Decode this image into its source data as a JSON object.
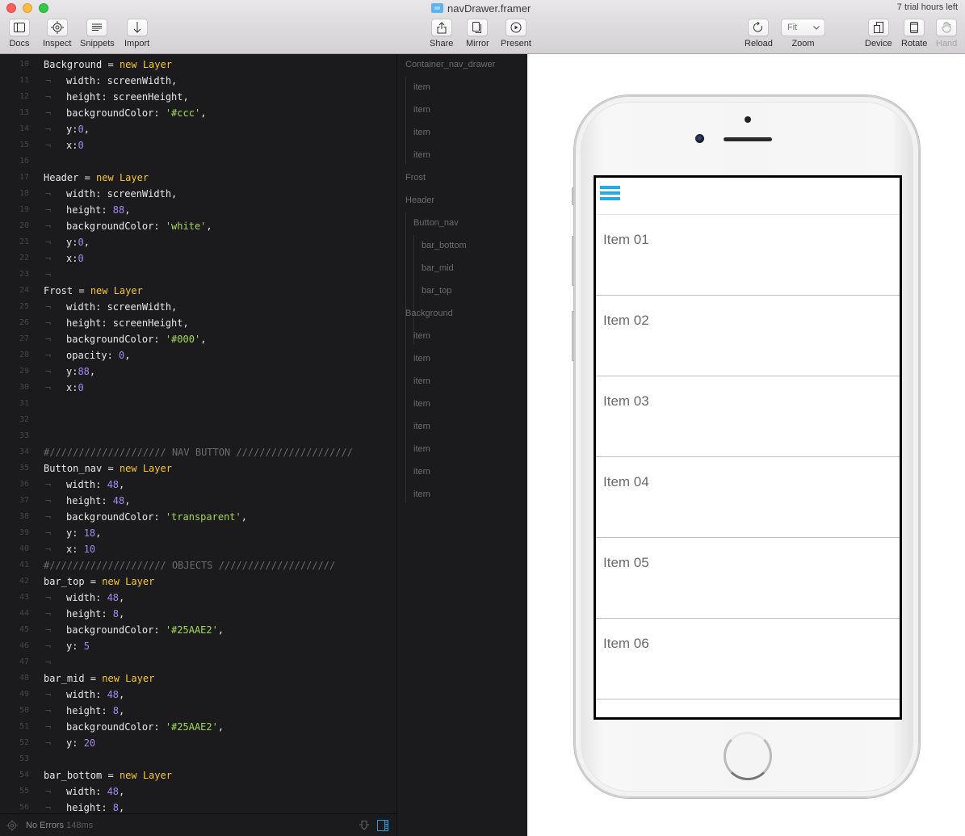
{
  "window": {
    "title": "navDrawer.framer",
    "trial_notice": "7 trial hours left"
  },
  "toolbar": {
    "left": [
      {
        "label": "Docs",
        "icon": "sidebar-icon"
      },
      {
        "label": "Inspect",
        "icon": "crosshair-icon"
      },
      {
        "label": "Snippets",
        "icon": "lines-icon"
      },
      {
        "label": "Import",
        "icon": "arrow-down-icon"
      }
    ],
    "center": [
      {
        "label": "Share",
        "icon": "share-icon"
      },
      {
        "label": "Mirror",
        "icon": "mirror-icon"
      },
      {
        "label": "Present",
        "icon": "play-icon"
      }
    ],
    "reload_label": "Reload",
    "zoom_label": "Zoom",
    "zoom_value": "Fit",
    "right": [
      {
        "label": "Device",
        "icon": "device-icon",
        "enabled": true
      },
      {
        "label": "Rotate",
        "icon": "rotate-icon",
        "enabled": true
      },
      {
        "label": "Hand",
        "icon": "hand-icon",
        "enabled": false
      }
    ]
  },
  "editor": {
    "lines": [
      {
        "n": "10",
        "parts": [
          [
            "id",
            "Background"
          ],
          [
            "op",
            " = "
          ],
          [
            "kw",
            "new Layer"
          ]
        ]
      },
      {
        "n": "11",
        "tab": true,
        "parts": [
          [
            "id",
            "width: screenWidth,"
          ]
        ]
      },
      {
        "n": "12",
        "tab": true,
        "parts": [
          [
            "id",
            "height: screenHeight,"
          ]
        ]
      },
      {
        "n": "13",
        "tab": true,
        "parts": [
          [
            "id",
            "backgroundColor: "
          ],
          [
            "str",
            "'#ccc'"
          ],
          [
            "id",
            ","
          ]
        ]
      },
      {
        "n": "14",
        "tab": true,
        "parts": [
          [
            "id",
            "y:"
          ],
          [
            "num",
            "0"
          ],
          [
            "id",
            ","
          ]
        ]
      },
      {
        "n": "15",
        "tab": true,
        "parts": [
          [
            "id",
            "x:"
          ],
          [
            "num",
            "0"
          ]
        ]
      },
      {
        "n": "16",
        "parts": []
      },
      {
        "n": "17",
        "parts": [
          [
            "id",
            "Header"
          ],
          [
            "op",
            " = "
          ],
          [
            "kw",
            "new Layer"
          ]
        ]
      },
      {
        "n": "18",
        "tab": true,
        "parts": [
          [
            "id",
            "width: screenWidth,"
          ]
        ]
      },
      {
        "n": "19",
        "tab": true,
        "parts": [
          [
            "id",
            "height: "
          ],
          [
            "num",
            "88"
          ],
          [
            "id",
            ","
          ]
        ]
      },
      {
        "n": "20",
        "tab": true,
        "parts": [
          [
            "id",
            "backgroundColor: "
          ],
          [
            "str",
            "'white'"
          ],
          [
            "id",
            ","
          ]
        ]
      },
      {
        "n": "21",
        "tab": true,
        "parts": [
          [
            "id",
            "y:"
          ],
          [
            "num",
            "0"
          ],
          [
            "id",
            ","
          ]
        ]
      },
      {
        "n": "22",
        "tab": true,
        "parts": [
          [
            "id",
            "x:"
          ],
          [
            "num",
            "0"
          ]
        ]
      },
      {
        "n": "23",
        "tab": true,
        "parts": []
      },
      {
        "n": "24",
        "parts": [
          [
            "id",
            "Frost"
          ],
          [
            "op",
            " = "
          ],
          [
            "kw",
            "new Layer"
          ]
        ]
      },
      {
        "n": "25",
        "tab": true,
        "parts": [
          [
            "id",
            "width: screenWidth,"
          ]
        ]
      },
      {
        "n": "26",
        "tab": true,
        "parts": [
          [
            "id",
            "height: screenHeight,"
          ]
        ]
      },
      {
        "n": "27",
        "tab": true,
        "parts": [
          [
            "id",
            "backgroundColor: "
          ],
          [
            "str",
            "'#000'"
          ],
          [
            "id",
            ","
          ]
        ]
      },
      {
        "n": "28",
        "tab": true,
        "parts": [
          [
            "id",
            "opacity: "
          ],
          [
            "num",
            "0"
          ],
          [
            "id",
            ","
          ]
        ]
      },
      {
        "n": "29",
        "tab": true,
        "parts": [
          [
            "id",
            "y:"
          ],
          [
            "num",
            "88"
          ],
          [
            "id",
            ","
          ]
        ]
      },
      {
        "n": "30",
        "tab": true,
        "parts": [
          [
            "id",
            "x:"
          ],
          [
            "num",
            "0"
          ]
        ]
      },
      {
        "n": "31",
        "parts": []
      },
      {
        "n": "32",
        "parts": []
      },
      {
        "n": "33",
        "parts": []
      },
      {
        "n": "34",
        "parts": [
          [
            "cmt",
            "#//////////////////// NAV BUTTON ////////////////////"
          ]
        ]
      },
      {
        "n": "35",
        "parts": [
          [
            "id",
            "Button_nav"
          ],
          [
            "op",
            " = "
          ],
          [
            "kw",
            "new Layer"
          ]
        ]
      },
      {
        "n": "36",
        "tab": true,
        "parts": [
          [
            "id",
            "width: "
          ],
          [
            "num",
            "48"
          ],
          [
            "id",
            ","
          ]
        ]
      },
      {
        "n": "37",
        "tab": true,
        "parts": [
          [
            "id",
            "height: "
          ],
          [
            "num",
            "48"
          ],
          [
            "id",
            ","
          ]
        ]
      },
      {
        "n": "38",
        "tab": true,
        "parts": [
          [
            "id",
            "backgroundColor: "
          ],
          [
            "str",
            "'transparent'"
          ],
          [
            "id",
            ","
          ]
        ]
      },
      {
        "n": "39",
        "tab": true,
        "parts": [
          [
            "id",
            "y: "
          ],
          [
            "num",
            "18"
          ],
          [
            "id",
            ","
          ]
        ]
      },
      {
        "n": "40",
        "tab": true,
        "parts": [
          [
            "id",
            "x: "
          ],
          [
            "num",
            "10"
          ]
        ]
      },
      {
        "n": "41",
        "parts": [
          [
            "cmt",
            "#//////////////////// OBJECTS ////////////////////"
          ]
        ]
      },
      {
        "n": "42",
        "parts": [
          [
            "id",
            "bar_top"
          ],
          [
            "op",
            " = "
          ],
          [
            "kw",
            "new Layer"
          ]
        ]
      },
      {
        "n": "43",
        "tab": true,
        "parts": [
          [
            "id",
            "width: "
          ],
          [
            "num",
            "48"
          ],
          [
            "id",
            ","
          ]
        ]
      },
      {
        "n": "44",
        "tab": true,
        "parts": [
          [
            "id",
            "height: "
          ],
          [
            "num",
            "8"
          ],
          [
            "id",
            ","
          ]
        ]
      },
      {
        "n": "45",
        "tab": true,
        "parts": [
          [
            "id",
            "backgroundColor: "
          ],
          [
            "str",
            "'#25AAE2'"
          ],
          [
            "id",
            ","
          ]
        ]
      },
      {
        "n": "46",
        "tab": true,
        "parts": [
          [
            "id",
            "y: "
          ],
          [
            "num",
            "5"
          ]
        ]
      },
      {
        "n": "47",
        "tab": true,
        "parts": []
      },
      {
        "n": "48",
        "parts": [
          [
            "id",
            "bar_mid"
          ],
          [
            "op",
            " = "
          ],
          [
            "kw",
            "new Layer"
          ]
        ]
      },
      {
        "n": "49",
        "tab": true,
        "parts": [
          [
            "id",
            "width: "
          ],
          [
            "num",
            "48"
          ],
          [
            "id",
            ","
          ]
        ]
      },
      {
        "n": "50",
        "tab": true,
        "parts": [
          [
            "id",
            "height: "
          ],
          [
            "num",
            "8"
          ],
          [
            "id",
            ","
          ]
        ]
      },
      {
        "n": "51",
        "tab": true,
        "parts": [
          [
            "id",
            "backgroundColor: "
          ],
          [
            "str",
            "'#25AAE2'"
          ],
          [
            "id",
            ","
          ]
        ]
      },
      {
        "n": "52",
        "tab": true,
        "parts": [
          [
            "id",
            "y: "
          ],
          [
            "num",
            "20"
          ]
        ]
      },
      {
        "n": "53",
        "parts": []
      },
      {
        "n": "54",
        "parts": [
          [
            "id",
            "bar_bottom"
          ],
          [
            "op",
            " = "
          ],
          [
            "kw",
            "new Layer"
          ]
        ]
      },
      {
        "n": "55",
        "tab": true,
        "parts": [
          [
            "id",
            "width: "
          ],
          [
            "num",
            "48"
          ],
          [
            "id",
            ","
          ]
        ]
      },
      {
        "n": "56",
        "tab": true,
        "parts": [
          [
            "id",
            "height: "
          ],
          [
            "num",
            "8"
          ],
          [
            "id",
            ","
          ]
        ]
      }
    ],
    "status": {
      "message": "No Errors",
      "time": "148ms"
    }
  },
  "layers": [
    {
      "name": "Container_nav_drawer",
      "depth": 0
    },
    {
      "name": "item",
      "depth": 1
    },
    {
      "name": "item",
      "depth": 1
    },
    {
      "name": "item",
      "depth": 1
    },
    {
      "name": "item",
      "depth": 1
    },
    {
      "name": "Frost",
      "depth": 0
    },
    {
      "name": "Header",
      "depth": 0
    },
    {
      "name": "Button_nav",
      "depth": 1
    },
    {
      "name": "bar_bottom",
      "depth": 2
    },
    {
      "name": "bar_mid",
      "depth": 2
    },
    {
      "name": "bar_top",
      "depth": 2
    },
    {
      "name": "Background",
      "depth": 0
    },
    {
      "name": "item",
      "depth": 1
    },
    {
      "name": "item",
      "depth": 1
    },
    {
      "name": "item",
      "depth": 1
    },
    {
      "name": "item",
      "depth": 1
    },
    {
      "name": "item",
      "depth": 1
    },
    {
      "name": "item",
      "depth": 1
    },
    {
      "name": "item",
      "depth": 1
    },
    {
      "name": "item",
      "depth": 1
    }
  ],
  "preview": {
    "accent_color": "#25AAE2",
    "items": [
      "Item 01",
      "Item 02",
      "Item 03",
      "Item 04",
      "Item 05",
      "Item 06",
      ""
    ]
  }
}
